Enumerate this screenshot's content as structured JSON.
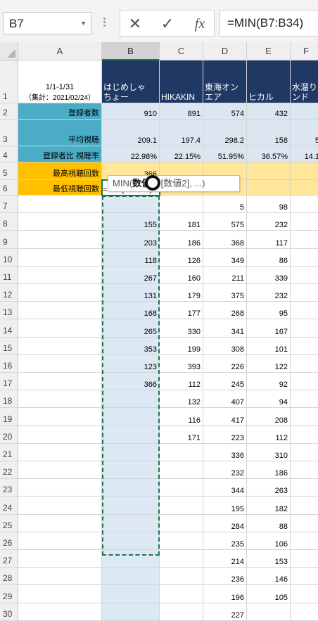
{
  "name_box": {
    "value": "B7"
  },
  "formula_bar": {
    "cancel_glyph": "✕",
    "enter_glyph": "✓",
    "fx_label": "fx",
    "formula": "=MIN(B7:B34)"
  },
  "columns": [
    "A",
    "B",
    "C",
    "D",
    "E",
    "F"
  ],
  "header_row": {
    "a_line1": "1/1-1/31",
    "a_line2": "（集計：2021/02/24）",
    "b": "はじめしゃ\nちょー",
    "c": "HIKAKIN",
    "d": "東海オン\nエア",
    "e": "ヒカル",
    "f": "水溜り\nンド"
  },
  "summary_rows": [
    {
      "label": "登録者数",
      "values": [
        "910",
        "891",
        "574",
        "432",
        ""
      ]
    },
    {
      "label": "平均視聴",
      "values": [
        "209.1",
        "197.4",
        "298.2",
        "158",
        "5"
      ]
    },
    {
      "label": "登録者比 視聴率",
      "values": [
        "22.98%",
        "22.15%",
        "51.95%",
        "36.57%",
        "14.1"
      ]
    },
    {
      "label": "最高視聴回数",
      "values": [
        "366",
        "",
        "",
        "",
        ""
      ]
    },
    {
      "label": "最低視聴回数",
      "values": [
        "=MIN(B7:B34)",
        "",
        "",
        "",
        ""
      ]
    }
  ],
  "data_rows": [
    {
      "row": "7",
      "values": [
        "",
        "",
        "5",
        "98",
        ""
      ]
    },
    {
      "row": "8",
      "values": [
        "155",
        "181",
        "575",
        "232",
        ""
      ]
    },
    {
      "row": "9",
      "values": [
        "203",
        "186",
        "368",
        "117",
        ""
      ]
    },
    {
      "row": "10",
      "values": [
        "118",
        "126",
        "349",
        "86",
        ""
      ]
    },
    {
      "row": "11",
      "values": [
        "267",
        "160",
        "211",
        "339",
        ""
      ]
    },
    {
      "row": "12",
      "values": [
        "131",
        "179",
        "375",
        "232",
        ""
      ]
    },
    {
      "row": "13",
      "values": [
        "168",
        "177",
        "268",
        "95",
        ""
      ]
    },
    {
      "row": "14",
      "values": [
        "265",
        "330",
        "341",
        "167",
        ""
      ]
    },
    {
      "row": "15",
      "values": [
        "353",
        "199",
        "308",
        "101",
        ""
      ]
    },
    {
      "row": "16",
      "values": [
        "123",
        "393",
        "226",
        "122",
        ""
      ]
    },
    {
      "row": "17",
      "values": [
        "366",
        "112",
        "245",
        "92",
        ""
      ]
    },
    {
      "row": "18",
      "values": [
        "",
        "132",
        "407",
        "94",
        ""
      ]
    },
    {
      "row": "19",
      "values": [
        "",
        "116",
        "417",
        "208",
        ""
      ]
    },
    {
      "row": "20",
      "values": [
        "",
        "171",
        "223",
        "112",
        ""
      ]
    },
    {
      "row": "21",
      "values": [
        "",
        "",
        "336",
        "310",
        ""
      ]
    },
    {
      "row": "22",
      "values": [
        "",
        "",
        "232",
        "186",
        ""
      ]
    },
    {
      "row": "23",
      "values": [
        "",
        "",
        "344",
        "263",
        ""
      ]
    },
    {
      "row": "24",
      "values": [
        "",
        "",
        "195",
        "182",
        ""
      ]
    },
    {
      "row": "25",
      "values": [
        "",
        "",
        "284",
        "88",
        ""
      ]
    },
    {
      "row": "26",
      "values": [
        "",
        "",
        "235",
        "106",
        ""
      ]
    },
    {
      "row": "27",
      "values": [
        "",
        "",
        "214",
        "153",
        ""
      ]
    },
    {
      "row": "28",
      "values": [
        "",
        "",
        "236",
        "146",
        ""
      ]
    },
    {
      "row": "29",
      "values": [
        "",
        "",
        "196",
        "105",
        ""
      ]
    },
    {
      "row": "30",
      "values": [
        "",
        "",
        "227",
        "",
        ""
      ]
    }
  ],
  "tooltip": {
    "fn": "MIN(",
    "arg1": "数値1",
    "rest": ", [数値2], ...)"
  },
  "colors": {
    "header_navy": "#1f3864",
    "label_teal": "#4bacc6",
    "label_orange": "#ffc000",
    "value_blue": "#dce6f1",
    "value_yellow": "#ffe699",
    "range_blue": "#dde8f5",
    "excel_green": "#217346"
  }
}
